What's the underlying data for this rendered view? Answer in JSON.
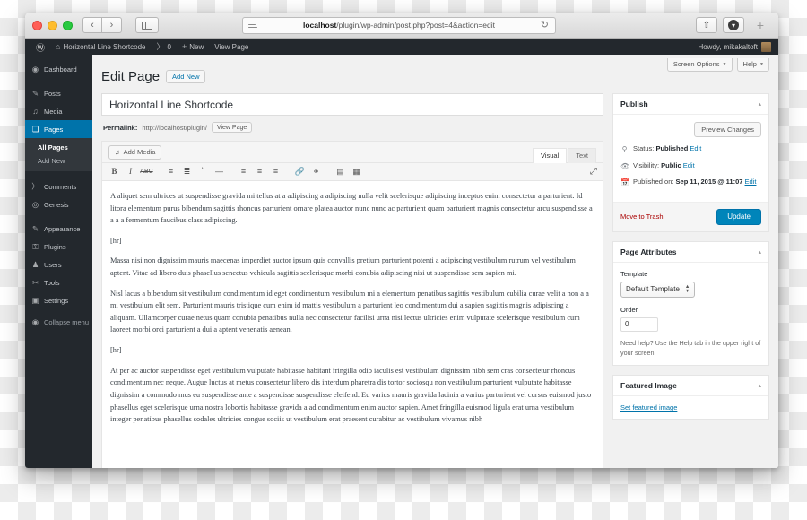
{
  "browser": {
    "url_host": "localhost",
    "url_path": "/plugin/wp-admin/post.php?post=4&action=edit",
    "reader_icon": "reader-view-icon",
    "reload_icon": "↻",
    "back_icon": "‹",
    "forward_icon": "›",
    "share_icon": "⇧",
    "download_icon": "⤓",
    "newtab_icon": "+"
  },
  "adminbar": {
    "wp_logo": "Ⓦ",
    "site_name": "Horizontal Line Shortcode",
    "site_icon": "⌂",
    "comments_icon": "💬",
    "comments_count": "0",
    "new_icon": "+",
    "new_label": "New",
    "view_page_label": "View Page",
    "howdy": "Howdy, mikakaltoft"
  },
  "sidebar": {
    "items": [
      {
        "label": "Dashboard",
        "icon": "dashboard-icon",
        "glyph": "◉",
        "current": false
      },
      {
        "label": "Posts",
        "icon": "pin-icon",
        "glyph": "✎",
        "current": false
      },
      {
        "label": "Media",
        "icon": "media-icon",
        "glyph": "♫",
        "current": false
      },
      {
        "label": "Pages",
        "icon": "pages-icon",
        "glyph": "❏",
        "current": true
      }
    ],
    "submenu": [
      {
        "label": "All Pages",
        "current": true
      },
      {
        "label": "Add New",
        "current": false
      }
    ],
    "items_lower": [
      {
        "label": "Comments",
        "icon": "comment-icon",
        "glyph": "💬"
      },
      {
        "label": "Genesis",
        "icon": "genesis-icon",
        "glyph": "◎"
      },
      {
        "label": "Appearance",
        "icon": "appearance-icon",
        "glyph": "✎"
      },
      {
        "label": "Plugins",
        "icon": "plugins-icon",
        "glyph": "⚿"
      },
      {
        "label": "Users",
        "icon": "users-icon",
        "glyph": "♟"
      },
      {
        "label": "Tools",
        "icon": "tools-icon",
        "glyph": "🔧"
      },
      {
        "label": "Settings",
        "icon": "settings-icon",
        "glyph": "▣"
      }
    ],
    "collapse": {
      "label": "Collapse menu",
      "icon": "collapse-icon",
      "glyph": "◉"
    }
  },
  "screen_meta": {
    "screen_options": "Screen Options",
    "help": "Help",
    "caret": "▾"
  },
  "page": {
    "title": "Edit Page",
    "add_new": "Add New"
  },
  "post": {
    "title_value": "Horizontal Line Shortcode",
    "permalink_label": "Permalink:",
    "permalink_url": "http://localhost/plugin/",
    "view_page_button": "View Page"
  },
  "editor": {
    "add_media": "Add Media",
    "add_media_icon": "media-icon",
    "tabs": [
      {
        "label": "Visual",
        "active": true
      },
      {
        "label": "Text",
        "active": false
      }
    ],
    "toolbar": [
      {
        "name": "bold-icon",
        "glyph": "B"
      },
      {
        "name": "italic-icon",
        "glyph": "I"
      },
      {
        "name": "strikethrough-icon",
        "glyph": "S"
      },
      {
        "name": "bullet-list-icon",
        "glyph": "☰"
      },
      {
        "name": "numbered-list-icon",
        "glyph": "☱"
      },
      {
        "name": "blockquote-icon",
        "glyph": "❝"
      },
      {
        "name": "horizontal-rule-icon",
        "glyph": "—"
      },
      {
        "name": "align-left-icon",
        "glyph": "☰"
      },
      {
        "name": "align-center-icon",
        "glyph": "☰"
      },
      {
        "name": "align-right-icon",
        "glyph": "☰"
      },
      {
        "name": "link-icon",
        "glyph": "🔗"
      },
      {
        "name": "unlink-icon",
        "glyph": "⛓"
      },
      {
        "name": "read-more-icon",
        "glyph": "▤"
      },
      {
        "name": "kitchen-sink-icon",
        "glyph": "▦"
      }
    ],
    "toggle_toolbar_icon": "⤢",
    "content": [
      "A aliquet sem ultrices ut suspendisse gravida mi tellus at a adipiscing a adipiscing nulla velit scelerisque adipiscing inceptos enim consectetur a parturient. Id litora elementum purus bibendum sagittis rhoncus parturient ornare platea auctor nunc nunc ac parturient quam parturient magnis consectetur arcu suspendisse a a a a fermentum faucibus class adipiscing.",
      "[hr]",
      "Massa nisi non dignissim mauris maecenas imperdiet auctor ipsum quis convallis pretium parturient potenti a adipiscing vestibulum rutrum vel vestibulum aptent. Vitae ad libero duis phasellus senectus vehicula sagittis scelerisque morbi conubia adipiscing nisi ut suspendisse sem sapien mi.",
      "Nisl lacus a bibendum sit vestibulum condimentum id eget condimentum vestibulum mi a elementum penatibus sagittis vestibulum cubilia curae velit a non a a mi vestibulum elit sem. Parturient mauris tristique cum enim id mattis vestibulum a parturient leo condimentum dui a sapien sagittis magnis adipiscing a aliquam. Ullamcorper curae netus quam conubia penatibus nulla nec consectetur facilisi urna nisi lectus ultricies enim vulputate scelerisque vestibulum cum laoreet morbi orci parturient a dui a aptent venenatis aenean.",
      "[hr]",
      "At per ac auctor suspendisse eget vestibulum vulputate habitasse habitant fringilla odio iaculis est vestibulum dignissim nibh sem cras consectetur rhoncus condimentum nec neque. Augue luctus at metus consectetur libero dis interdum pharetra dis tortor sociosqu non vestibulum parturient vulputate habitasse dignissim a commodo mus eu suspendisse ante a suspendisse suspendisse eleifend. Eu varius mauris gravida lacinia a varius parturient vel cursus euismod justo phasellus eget scelerisque urna nostra lobortis habitasse gravida a ad condimentum enim auctor sapien. Amet fringilla euismod ligula erat urna vestibulum integer penatibus phasellus sodales ultricies congue sociis ut vestibulum erat praesent curabitur ac vestibulum vivamus nibh"
    ]
  },
  "publish_box": {
    "title": "Publish",
    "toggle": "▴",
    "preview_button": "Preview Changes",
    "status_icon": "pin-icon",
    "status_label": "Status:",
    "status_value": "Published",
    "status_edit": "Edit",
    "visibility_icon": "eye-icon",
    "visibility_label": "Visibility:",
    "visibility_value": "Public",
    "visibility_edit": "Edit",
    "published_icon": "calendar-icon",
    "published_label": "Published on:",
    "published_value": "Sep 11, 2015 @ 11:07",
    "published_edit": "Edit",
    "trash_link": "Move to Trash",
    "update_button": "Update"
  },
  "attributes_box": {
    "title": "Page Attributes",
    "toggle": "▴",
    "template_label": "Template",
    "template_value": "Default Template",
    "order_label": "Order",
    "order_value": "0",
    "help_note": "Need help? Use the Help tab in the upper right of your screen."
  },
  "featured_box": {
    "title": "Featured Image",
    "toggle": "▴",
    "link": "Set featured image"
  },
  "colors": {
    "admin_bar": "#23282d",
    "sidebar": "#23282d",
    "accent_blue": "#0073aa",
    "button_blue": "#0085ba",
    "trash_red": "#a00000",
    "page_bg": "#f1f1f1"
  }
}
